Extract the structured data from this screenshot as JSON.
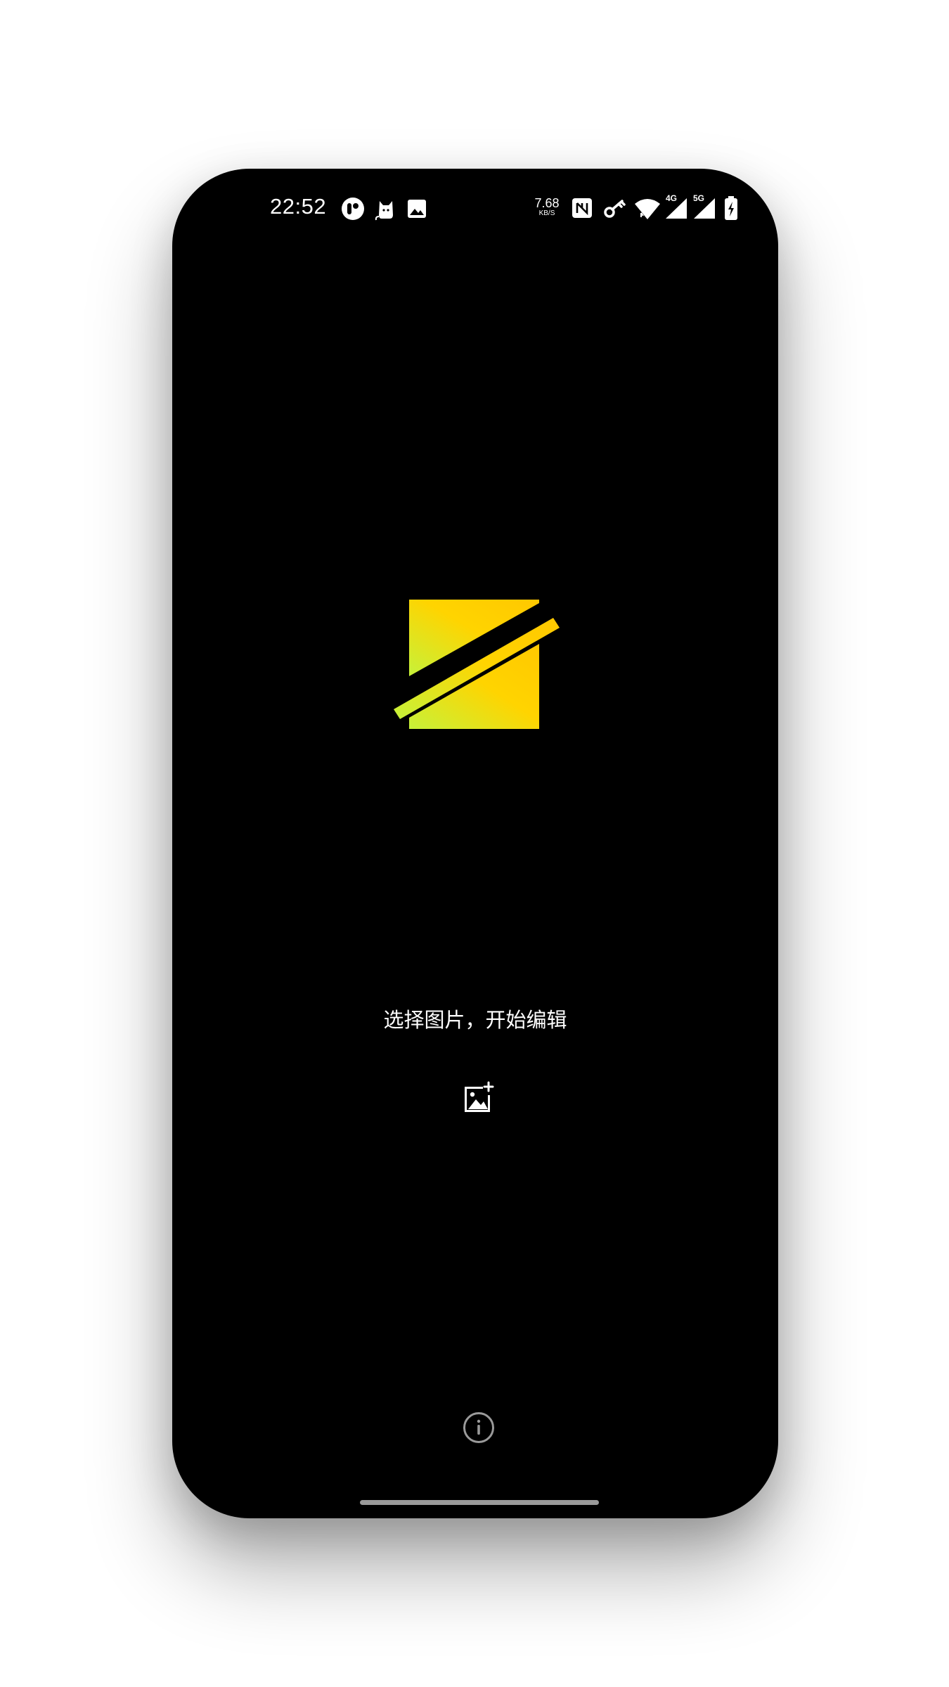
{
  "status_bar": {
    "time": "22:52",
    "left_icons": [
      "record-app-icon",
      "cat-app-icon",
      "gallery-notification-icon"
    ],
    "net_speed_value": "7.68",
    "net_speed_unit": "KB/S",
    "right_icons": [
      "nfc-icon",
      "vpn-key-icon",
      "wifi-icon",
      "signal-4g-icon",
      "signal-5g-icon",
      "battery-charging-icon"
    ],
    "signal_1_label": "4G",
    "signal_2_label": "5G"
  },
  "main": {
    "logo": "app-logo",
    "prompt": "选择图片，开始编辑",
    "add_image_icon": "add-image-icon",
    "info_icon": "info-icon"
  },
  "colors": {
    "background": "#000000",
    "text": "#ffffff",
    "logo_gradient_start": "#c6f23a",
    "logo_gradient_end": "#ffc800",
    "muted_icon": "#9a9a9a"
  }
}
